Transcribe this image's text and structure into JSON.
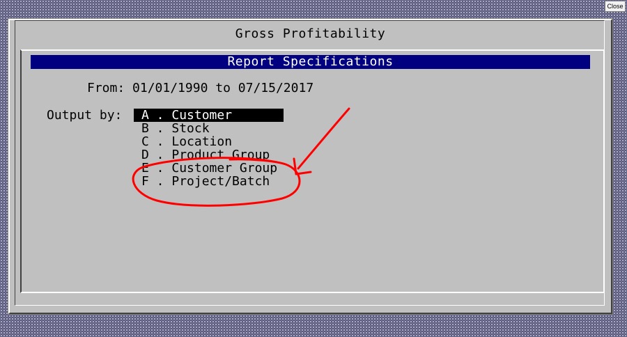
{
  "close_label": "Close",
  "window": {
    "title": "Gross Profitability",
    "header": "Report Specifications",
    "from_label": "From:",
    "date_from": "01/01/1990",
    "to_label": "to",
    "date_to": "07/15/2017",
    "output_label": "Output by:",
    "options": [
      {
        "key": "A",
        "label": "Customer",
        "selected": true
      },
      {
        "key": "B",
        "label": "Stock",
        "selected": false
      },
      {
        "key": "C",
        "label": "Location",
        "selected": false
      },
      {
        "key": "D",
        "label": "Product Group",
        "selected": false
      },
      {
        "key": "E",
        "label": "Customer Group",
        "selected": false
      },
      {
        "key": "F",
        "label": "Project/Batch",
        "selected": false
      }
    ]
  },
  "colors": {
    "header_bg": "#000080",
    "window_bg": "#c0c0c0",
    "annotation": "#ff0000"
  }
}
